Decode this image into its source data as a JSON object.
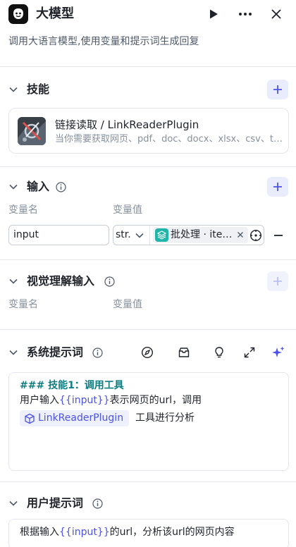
{
  "header": {
    "title": "大模型",
    "description": "调用大语言模型,使用变量和提示词生成回复",
    "logo_icon": "llm-robot-icon",
    "run_icon": "play-icon",
    "more_icon": "more-dots-icon",
    "close_icon": "close-icon"
  },
  "skills": {
    "title": "技能",
    "add_icon": "plus-icon",
    "items": [
      {
        "name": "链接读取 / LinkReaderPlugin",
        "description": "当你需要获取网页、pdf、doc、docx、xlsx、csv、text 内容时，使用此工具",
        "image": "plugin-cover-image"
      }
    ]
  },
  "input": {
    "title": "输入",
    "info_icon": "info-icon",
    "add_icon": "plus-icon",
    "col_name": "变量名",
    "col_value": "变量值",
    "rows": [
      {
        "name": "input",
        "type": "str.",
        "ref_label": "批处理 · item_url",
        "ref_icon": "layers-icon"
      }
    ]
  },
  "vision_input": {
    "title": "视觉理解输入",
    "info_icon": "info-icon",
    "col_name": "变量名",
    "col_value": "变量值"
  },
  "system_prompt": {
    "title": "系统提示词",
    "toolbar_icons": [
      "compass-icon",
      "library-icon",
      "bulb-icon",
      "expand-icon",
      "ai-sparkle-icon"
    ],
    "lines": {
      "heading": "### 技能1：调用工具",
      "line2_prefix": "用户输入",
      "line2_var": "{{input}}",
      "line2_suffix": "表示网页的url，调用",
      "plugin_chip": "LinkReaderPlugin",
      "after_chip": "工具进行分析"
    }
  },
  "user_prompt": {
    "title": "用户提示词",
    "info_icon": "info-icon",
    "prefix": "根据输入",
    "var": "{{input}}",
    "suffix": "的url，分析该url的网页内容"
  },
  "colors": {
    "accent": "#4d53e8",
    "accent_bg": "#e8ecfd",
    "teal": "#1fb5a8",
    "heading_teal": "#0e7d80",
    "border": "#e5e6eb",
    "muted": "#86909c"
  }
}
